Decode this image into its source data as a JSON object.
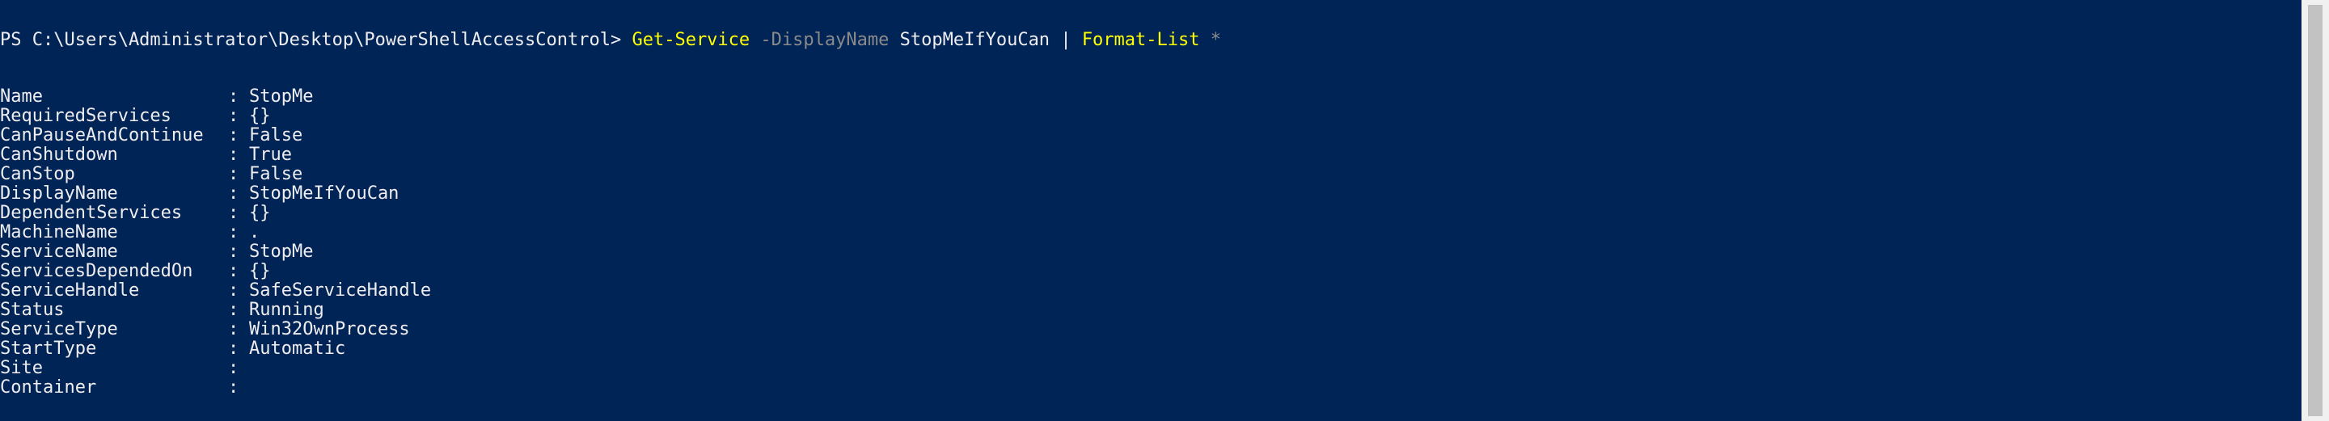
{
  "console": {
    "prompt": "PS C:\\Users\\Administrator\\Desktop\\PowerShellAccessControl> ",
    "cmdlet": "Get-Service",
    "param": "-DisplayName",
    "arg": "StopMeIfYouCan",
    "pipe": "|",
    "cmdlet2": "Format-List",
    "star": "*"
  },
  "output": {
    "separator": ":",
    "rows": [
      {
        "key": "Name",
        "value": "StopMe"
      },
      {
        "key": "RequiredServices",
        "value": "{}"
      },
      {
        "key": "CanPauseAndContinue",
        "value": "False"
      },
      {
        "key": "CanShutdown",
        "value": "True"
      },
      {
        "key": "CanStop",
        "value": "False"
      },
      {
        "key": "DisplayName",
        "value": "StopMeIfYouCan"
      },
      {
        "key": "DependentServices",
        "value": "{}"
      },
      {
        "key": "MachineName",
        "value": "."
      },
      {
        "key": "ServiceName",
        "value": "StopMe"
      },
      {
        "key": "ServicesDependedOn",
        "value": "{}"
      },
      {
        "key": "ServiceHandle",
        "value": "SafeServiceHandle"
      },
      {
        "key": "Status",
        "value": "Running"
      },
      {
        "key": "ServiceType",
        "value": "Win32OwnProcess"
      },
      {
        "key": "StartType",
        "value": "Automatic"
      },
      {
        "key": "Site",
        "value": ""
      },
      {
        "key": "Container",
        "value": ""
      }
    ]
  },
  "colors": {
    "background": "#012456",
    "foreground": "#eeedf0",
    "cmdlet": "#ffff00",
    "parameter": "#8a8a8a"
  }
}
